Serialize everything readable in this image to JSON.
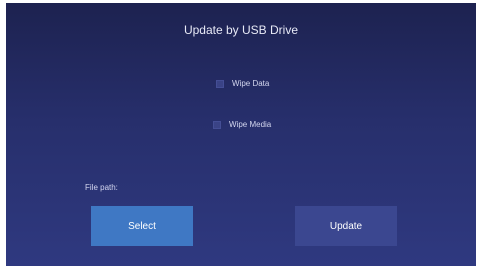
{
  "dialog": {
    "title": "Update by USB Drive",
    "options": [
      {
        "label": "Wipe Data",
        "checked": false
      },
      {
        "label": "Wipe Media",
        "checked": false
      }
    ],
    "file_path_label": "File path:",
    "buttons": {
      "select_label": "Select",
      "update_label": "Update"
    }
  },
  "colors": {
    "background_top": "#1d2250",
    "background_bottom": "#2f3980",
    "select_button": "#3f78c4",
    "update_button": "#3b4790"
  }
}
